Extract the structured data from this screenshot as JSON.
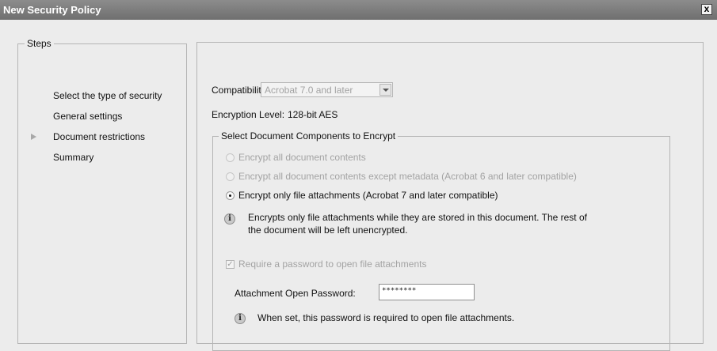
{
  "window": {
    "title": "New Security Policy",
    "close_glyph": "x"
  },
  "steps": {
    "legend": "Steps",
    "items": [
      {
        "label": "Select the type of security",
        "current": false
      },
      {
        "label": "General settings",
        "current": false
      },
      {
        "label": "Document restrictions",
        "current": true
      },
      {
        "label": "Summary",
        "current": false
      }
    ]
  },
  "main": {
    "compatibility_label": "Compatibility:",
    "compatibility_value": "Acrobat 7.0 and later",
    "encryption_label": "Encryption Level:",
    "encryption_value": "128-bit AES",
    "group_legend": "Select Document Components to Encrypt",
    "options": [
      {
        "label": "Encrypt all document contents",
        "selected": false,
        "enabled": false
      },
      {
        "label": "Encrypt all document contents except metadata (Acrobat 6 and later compatible)",
        "selected": false,
        "enabled": false
      },
      {
        "label": "Encrypt only file attachments (Acrobat 7 and later compatible)",
        "selected": true,
        "enabled": true
      }
    ],
    "info_text_line1": "Encrypts only file attachments while they are stored in this document. The rest of",
    "info_text_line2": "the document will be left unencrypted.",
    "require_password_label": "Require a password to open file attachments",
    "require_password_checked": true,
    "password_label": "Attachment Open Password:",
    "password_value": "********",
    "password_info": "When set, this password is required to open file attachments."
  },
  "icons": {
    "info": "i",
    "checkmark": "✓"
  }
}
